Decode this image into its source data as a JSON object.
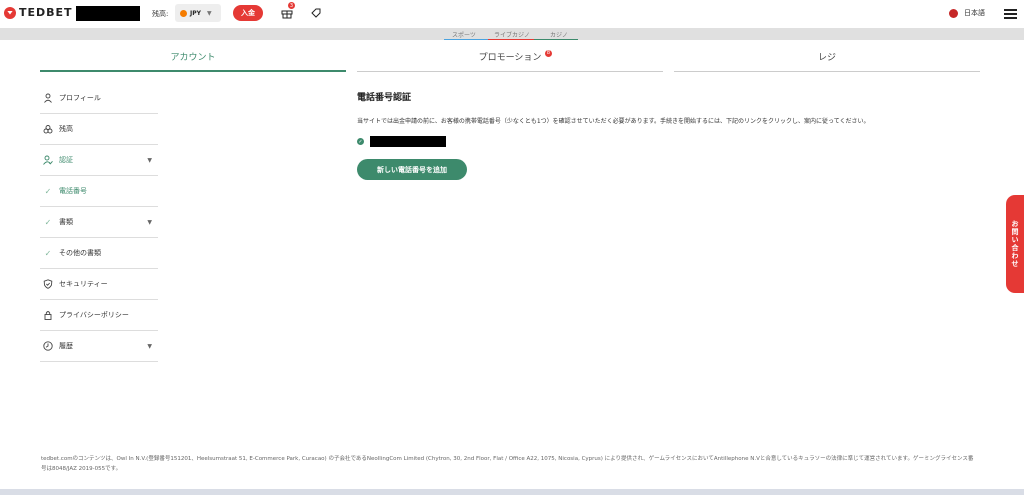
{
  "header": {
    "logo_text": "TEDBET",
    "balance_label": "残高: ",
    "currency": "JPY",
    "deposit_label": "入金",
    "gift_badge": "3",
    "language": "日本語"
  },
  "subnav": {
    "items": [
      {
        "label": "スポーツ",
        "color": "#4aa3df"
      },
      {
        "label": "ライブカジノ",
        "color": "#e53935"
      },
      {
        "label": "カジノ",
        "color": "#3d8a6c"
      }
    ]
  },
  "tabs": {
    "account": "アカウント",
    "promotion": "プロモーション",
    "promotion_badge": "8",
    "cashier": "レジ"
  },
  "sidebar": {
    "items": [
      {
        "label": "プロフィール",
        "icon": "user-icon"
      },
      {
        "label": "残高",
        "icon": "coins-icon"
      },
      {
        "label": "認証",
        "icon": "user-check-icon"
      },
      {
        "label": "電話番号",
        "icon": "check-icon"
      },
      {
        "label": "書類",
        "icon": "check-icon"
      },
      {
        "label": "その他の書類",
        "icon": "check-icon"
      },
      {
        "label": "セキュリティー",
        "icon": "shield-icon"
      },
      {
        "label": "プライバシーポリシー",
        "icon": "lock-icon"
      },
      {
        "label": "履歴",
        "icon": "clock-icon"
      }
    ]
  },
  "main": {
    "title": "電話番号認証",
    "description": "当サイトでは出金申請の前に、お客様の携帯電話番号（少なくとも1つ）を確認させていただく必要があります。手続きを開始するには、下記のリンクをクリックし、案内に従ってください。",
    "add_button": "新しい電話番号を追加"
  },
  "contact_tab": "お問い合わせ",
  "footer": {
    "text": "tedbet.comのコンテンツは、Owl In N.V.(登録番号151201、Heelsumstraat 51, E-Commerce Park, Curacao) の子会社であるNeollingCom Limited (Chytron, 30, 2nd Floor, Flat / Office A22, 1075, Nicosia, Cyprus) により提供され、ゲームライセンスにおいてAntillephone N.Vと合意しているキュラソーの法律に準じて運営されています。ゲーミングライセンス番号は8048/JAZ 2019-055です。"
  }
}
